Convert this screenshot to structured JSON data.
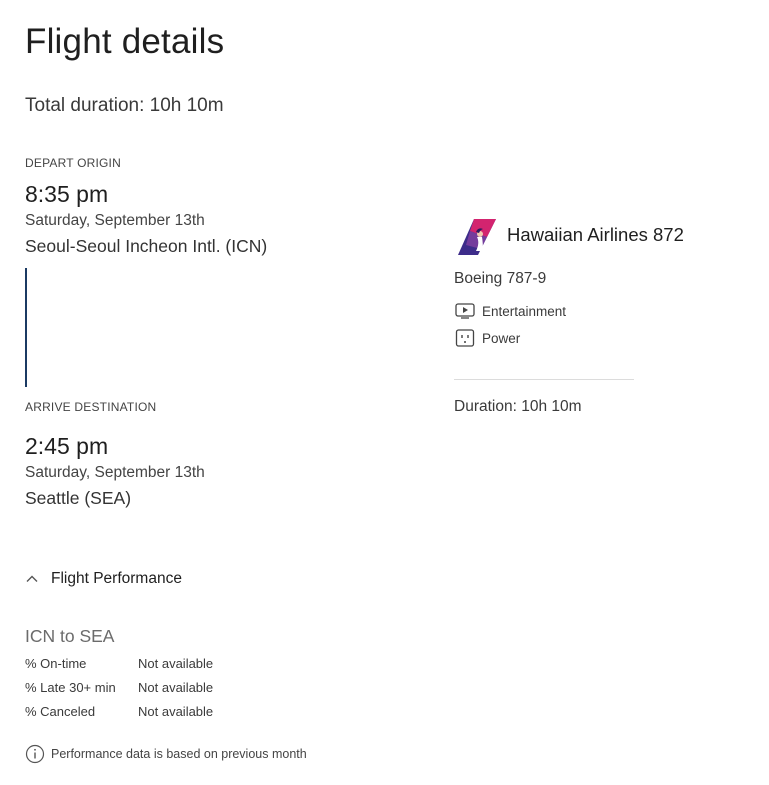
{
  "page": {
    "title": "Flight details",
    "total_duration": "Total duration: 10h 10m"
  },
  "depart": {
    "label": "DEPART ORIGIN",
    "time": "8:35 pm",
    "date": "Saturday, September 13th",
    "airport": "Seoul-Seoul Incheon Intl. (ICN)"
  },
  "arrive": {
    "label": "ARRIVE DESTINATION",
    "time": "2:45 pm",
    "date": "Saturday, September 13th",
    "airport": "Seattle (SEA)"
  },
  "flight": {
    "airline_logo": "hawaiian-airlines-logo",
    "airline": "Hawaiian Airlines 872",
    "aircraft": "Boeing 787-9",
    "amenities": [
      {
        "icon": "entertainment-icon",
        "label": "Entertainment"
      },
      {
        "icon": "power-outlet-icon",
        "label": "Power"
      }
    ],
    "duration": "Duration: 10h 10m"
  },
  "performance": {
    "toggle_icon": "chevron-up-icon",
    "toggle_label": "Flight Performance",
    "route": "ICN to SEA",
    "rows": [
      {
        "label": "% On-time",
        "value": "Not available"
      },
      {
        "label": "% Late 30+ min",
        "value": "Not available"
      },
      {
        "label": "% Canceled",
        "value": "Not available"
      }
    ],
    "note_icon": "info-icon",
    "note": "Performance data is based on previous month"
  },
  "colors": {
    "timeline": "#1b3a63",
    "logo_purple": "#3d2c8a",
    "logo_magenta": "#d3246f"
  }
}
